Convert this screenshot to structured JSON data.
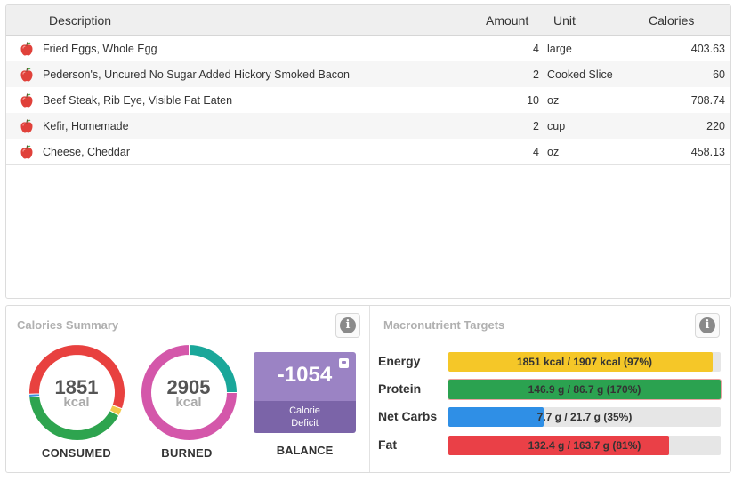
{
  "table": {
    "headers": {
      "description": "Description",
      "amount": "Amount",
      "unit": "Unit",
      "calories": "Calories"
    },
    "rows": [
      {
        "icon": "apple-icon",
        "description": "Fried Eggs, Whole Egg",
        "amount": "4",
        "unit": "large",
        "calories": "403.63"
      },
      {
        "icon": "apple-icon",
        "description": "Pederson's, Uncured No Sugar Added Hickory Smoked Bacon",
        "amount": "2",
        "unit": "Cooked Slice",
        "calories": "60"
      },
      {
        "icon": "apple-icon",
        "description": "Beef Steak, Rib Eye, Visible Fat Eaten",
        "amount": "10",
        "unit": "oz",
        "calories": "708.74"
      },
      {
        "icon": "apple-icon",
        "description": "Kefir, Homemade",
        "amount": "2",
        "unit": "cup",
        "calories": "220"
      },
      {
        "icon": "apple-icon",
        "description": "Cheese, Cheddar",
        "amount": "4",
        "unit": "oz",
        "calories": "458.13"
      }
    ]
  },
  "calories_summary": {
    "title": "Calories Summary",
    "info_icon": "info-icon",
    "consumed": {
      "value": "1851",
      "unit": "kcal",
      "caption": "CONSUMED",
      "segments": [
        {
          "color": "#e8413f",
          "fraction": 0.305
        },
        {
          "color": "#f2c94c",
          "fraction": 0.025
        },
        {
          "color": "#2ea44f",
          "fraction": 0.405
        },
        {
          "color": "#3b8fd9",
          "fraction": 0.01
        },
        {
          "color": "#e8413f",
          "fraction": 0.255
        }
      ]
    },
    "burned": {
      "value": "2905",
      "unit": "kcal",
      "caption": "BURNED",
      "segments": [
        {
          "color": "#1aa79a",
          "fraction": 0.25
        },
        {
          "color": "#d457aa",
          "fraction": 0.75
        }
      ]
    },
    "balance": {
      "value": "-1054",
      "line1": "Calorie",
      "line2": "Deficit",
      "caption": "BALANCE",
      "icon": "scale-icon"
    }
  },
  "macronutrient_targets": {
    "title": "Macronutrient Targets",
    "info_icon": "info-icon",
    "rows": [
      {
        "label": "Energy",
        "text": "1851 kcal / 1907 kcal (97%)",
        "fill": 0.97,
        "color": "#f5c728"
      },
      {
        "label": "Protein",
        "text": "146.9 g / 86.7 g (170%)",
        "fill": 1.0,
        "color": "#2ba250"
      },
      {
        "label": "Net Carbs",
        "text": "7.7 g / 21.7 g (35%)",
        "fill": 0.35,
        "color": "#2f8fe6"
      },
      {
        "label": "Fat",
        "text": "132.4 g / 163.7 g (81%)",
        "fill": 0.81,
        "color": "#ea4047"
      }
    ]
  }
}
